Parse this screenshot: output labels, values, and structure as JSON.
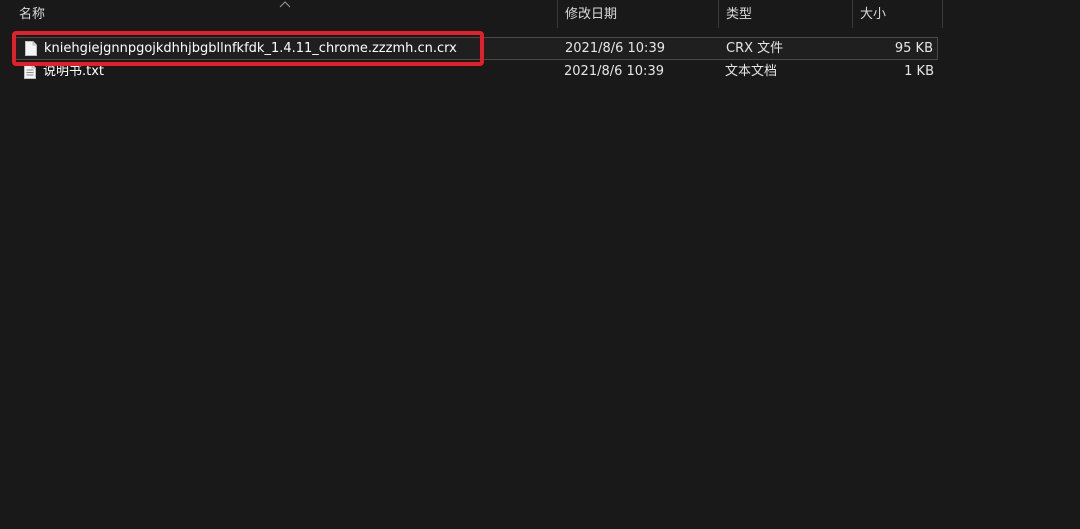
{
  "columns": {
    "name": "名称",
    "date": "修改日期",
    "type": "类型",
    "size": "大小"
  },
  "sort": {
    "column": "name",
    "direction": "ascending",
    "icon": "chevron-up-icon"
  },
  "files": [
    {
      "name": "kniehgiejgnnpgojkdhhjbgbllnfkfdk_1.4.11_chrome.zzzmh.cn.crx",
      "date": "2021/8/6 10:39",
      "type": "CRX 文件",
      "size": "95 KB",
      "icon": "file-icon",
      "selected": true
    },
    {
      "name": "说明书.txt",
      "date": "2021/8/6 10:39",
      "type": "文本文档",
      "size": "1 KB",
      "icon": "text-file-icon",
      "selected": false
    }
  ],
  "colors": {
    "background": "#191919",
    "highlight": "#e3202a",
    "header_text": "#d8d8d8"
  }
}
